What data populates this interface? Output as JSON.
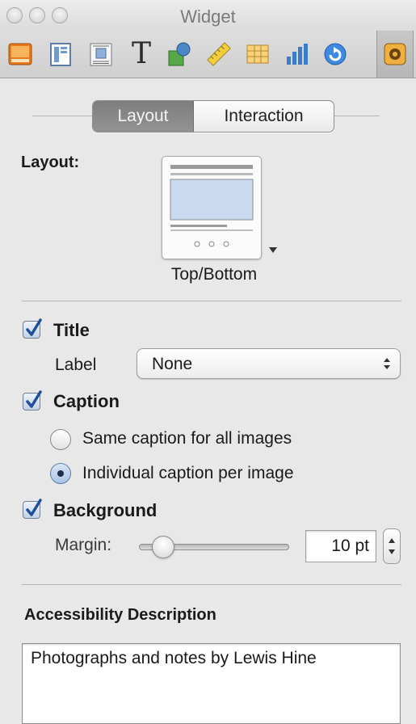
{
  "window": {
    "title": "Widget"
  },
  "toolbar": {
    "tools": [
      {
        "name": "document-icon"
      },
      {
        "name": "layout-icon"
      },
      {
        "name": "wrap-icon"
      },
      {
        "name": "text-icon",
        "glyph": "T"
      },
      {
        "name": "graphic-icon"
      },
      {
        "name": "metrics-icon"
      },
      {
        "name": "table-icon"
      },
      {
        "name": "chart-icon"
      },
      {
        "name": "link-icon"
      },
      {
        "name": "widget-icon",
        "active": true
      }
    ]
  },
  "tabs": {
    "layout": "Layout",
    "interaction": "Interaction",
    "selected": "Layout"
  },
  "layout_section": {
    "label": "Layout:",
    "selected_layout": "Top/Bottom"
  },
  "title_option": {
    "label": "Title",
    "checked": true
  },
  "label_row": {
    "label": "Label",
    "value": "None"
  },
  "caption_option": {
    "label": "Caption",
    "checked": true,
    "radio_same": "Same caption for all images",
    "radio_individual": "Individual caption per image",
    "selected": "individual"
  },
  "background_option": {
    "label": "Background",
    "checked": true
  },
  "margin": {
    "label": "Margin:",
    "value": "10 pt",
    "slider_fraction": 0.1
  },
  "accessibility": {
    "heading": "Accessibility Description",
    "text": "Photographs and notes by Lewis Hine"
  },
  "colors": {
    "check_blue": "#1e4f9a",
    "selected_segment": "#858585"
  }
}
